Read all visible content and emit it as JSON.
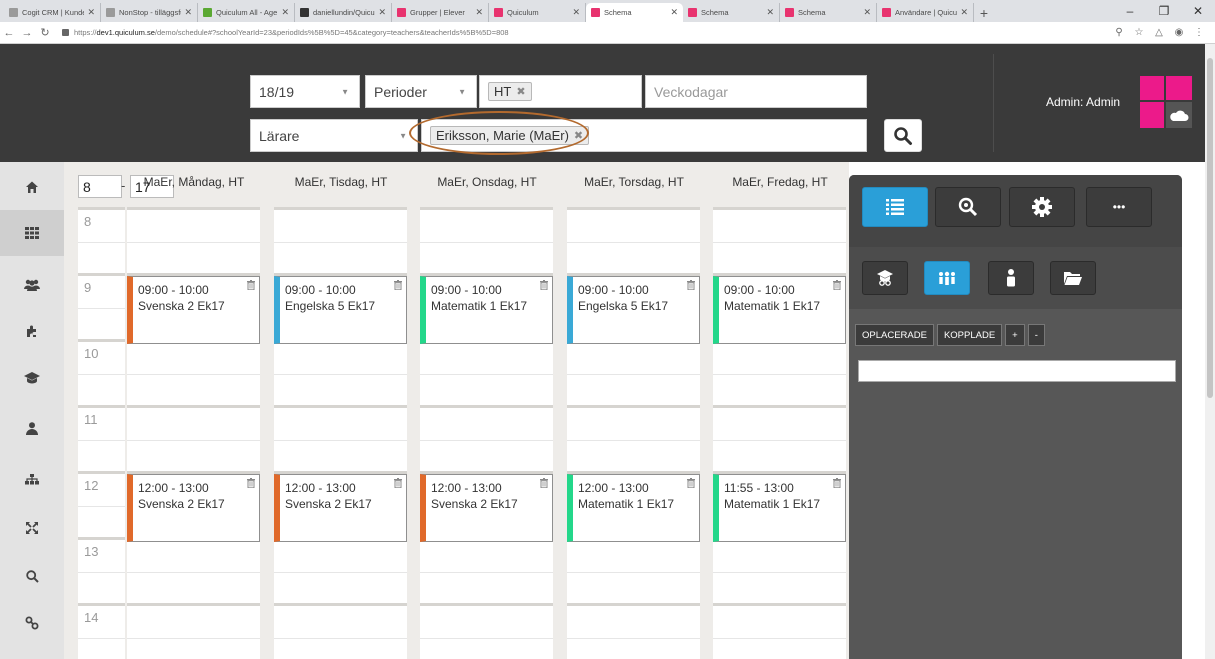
{
  "browser": {
    "tabs": [
      {
        "title": "Cogit CRM | Kunder",
        "icon_color": "#9a9a9a"
      },
      {
        "title": "NonStop - tilläggsfu",
        "icon_color": "#9a9a9a"
      },
      {
        "title": "Quiculum All - Age",
        "icon_color": "#5aa832"
      },
      {
        "title": "daniellundin/Quicu",
        "icon_color": "#333333"
      },
      {
        "title": "Grupper | Elever",
        "icon_color": "#e8336f"
      },
      {
        "title": "Quiculum",
        "icon_color": "#e8336f"
      },
      {
        "title": "Schema",
        "icon_color": "#e8336f",
        "active": true
      },
      {
        "title": "Schema",
        "icon_color": "#e8336f"
      },
      {
        "title": "Schema",
        "icon_color": "#e8336f"
      },
      {
        "title": "Användare | Quicul",
        "icon_color": "#e8336f"
      }
    ],
    "url_prefix": "https://",
    "url_host": "dev1.quiculum.se",
    "url_path": "/demo/schedule#?schoolYearId=23&periodIds%5B%5D=45&category=teachers&teacherIds%5B%5D=808"
  },
  "header": {
    "school_year": "18/19",
    "periods_label": "Perioder",
    "period_chip": "HT",
    "weekdays_placeholder": "Veckodagar",
    "category": "Lärare",
    "teacher_chip": "Eriksson, Marie (MaEr)",
    "admin_label": "Admin: Admin",
    "accent_color": "#ec1a8a"
  },
  "calendar": {
    "start_hour": "8",
    "end_hour": "17",
    "hours": [
      "8",
      "9",
      "10",
      "11",
      "12",
      "13",
      "14"
    ],
    "days": [
      {
        "heading": "MaEr, Måndag, HT",
        "events": [
          {
            "time": "09:00 - 10:00",
            "title": "Svenska 2 Ek17",
            "color": "#e0692a",
            "slot": 1
          },
          {
            "time": "12:00 - 13:00",
            "title": "Svenska 2 Ek17",
            "color": "#e0692a",
            "slot": 4
          }
        ]
      },
      {
        "heading": "MaEr, Tisdag, HT",
        "events": [
          {
            "time": "09:00 - 10:00",
            "title": "Engelska 5 Ek17",
            "color": "#3aa9d6",
            "slot": 1
          },
          {
            "time": "12:00 - 13:00",
            "title": "Svenska 2 Ek17",
            "color": "#e0692a",
            "slot": 4
          }
        ]
      },
      {
        "heading": "MaEr, Onsdag, HT",
        "events": [
          {
            "time": "09:00 - 10:00",
            "title": "Matematik 1 Ek17",
            "color": "#23d78a",
            "slot": 1
          },
          {
            "time": "12:00 - 13:00",
            "title": "Svenska 2 Ek17",
            "color": "#e0692a",
            "slot": 4
          }
        ]
      },
      {
        "heading": "MaEr, Torsdag, HT",
        "events": [
          {
            "time": "09:00 - 10:00",
            "title": "Engelska 5 Ek17",
            "color": "#3aa9d6",
            "slot": 1
          },
          {
            "time": "12:00 - 13:00",
            "title": "Matematik 1 Ek17",
            "color": "#23d78a",
            "slot": 4
          }
        ]
      },
      {
        "heading": "MaEr, Fredag, HT",
        "events": [
          {
            "time": "09:00 - 10:00",
            "title": "Matematik 1 Ek17",
            "color": "#23d78a",
            "slot": 1
          },
          {
            "time": "11:55 - 13:00",
            "title": "Matematik 1 Ek17",
            "color": "#23d78a",
            "slot": 4
          }
        ]
      }
    ]
  },
  "panel": {
    "unplaced_label": "OPLACERADE",
    "linked_label": "KOPPLADE",
    "plus_label": "+",
    "minus_label": "-",
    "more_label": "•••"
  }
}
